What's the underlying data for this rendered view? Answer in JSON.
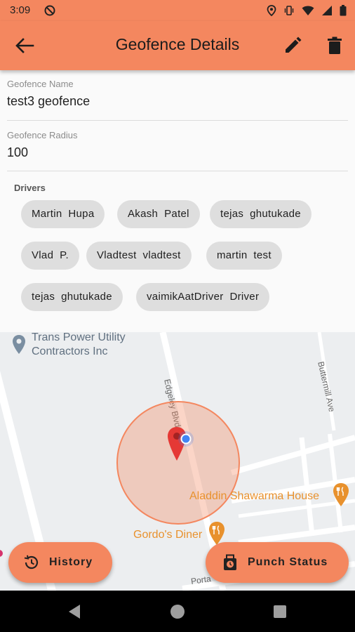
{
  "status_bar": {
    "time": "3:09"
  },
  "app_bar": {
    "title": "Geofence Details"
  },
  "fields": {
    "name": {
      "label": "Geofence Name",
      "value": "test3 geofence"
    },
    "radius": {
      "label": "Geofence Radius",
      "value": "100"
    }
  },
  "drivers": {
    "label": "Drivers",
    "chips": [
      "Martin  Hupa",
      "Akash  Patel",
      "tejas  ghutukade",
      "Vlad  P.",
      "Vladtest  vladtest",
      "martin  test",
      "tejas  ghutukade",
      "vaimikAatDriver  Driver"
    ]
  },
  "map": {
    "labels": {
      "trans_power_1": "Trans Power Utility",
      "trans_power_2": "Contractors Inc",
      "edgeley": "Edgeley Blvd",
      "buttermill": "Buttermill Ave",
      "aladdin": "Aladdin Shawarma House",
      "gordos": "Gordo's Diner",
      "portage": "Porta"
    },
    "geofence_color": "#f4875f"
  },
  "actions": {
    "history": "History",
    "punch_status": "Punch Status"
  },
  "colors": {
    "accent": "#f4875f",
    "chip": "#dedede",
    "poi_orange": "#e8912d",
    "marker_red": "#e53935"
  }
}
